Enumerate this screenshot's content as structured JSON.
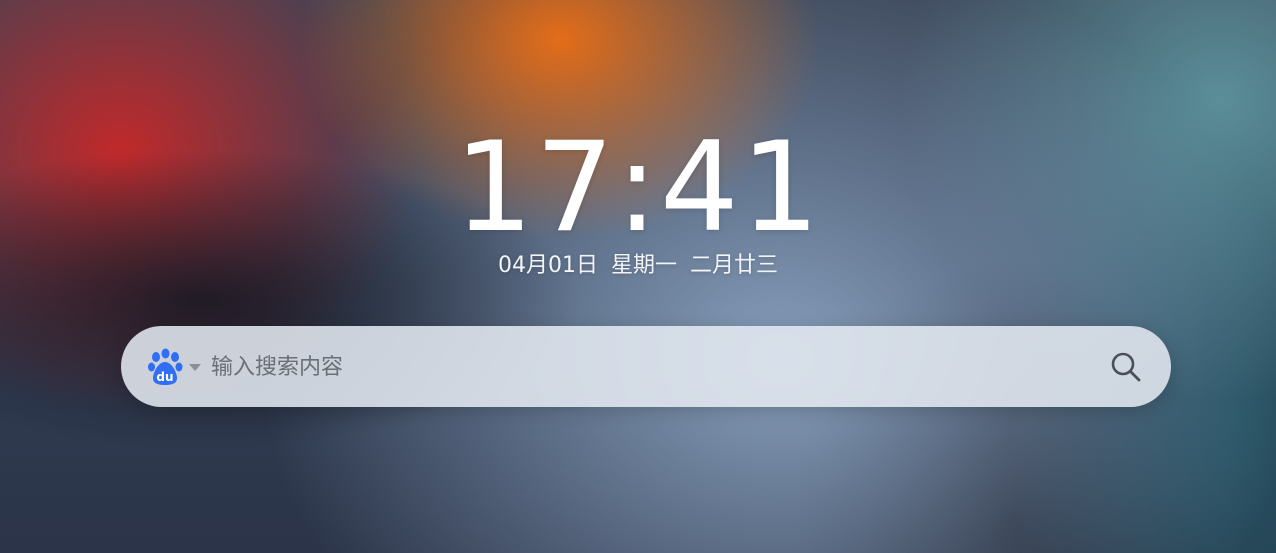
{
  "clock": {
    "time": "17:41",
    "date": "04月01日",
    "weekday": "星期一",
    "lunar_date": "二月廿三"
  },
  "search": {
    "engine": "baidu-icon",
    "placeholder": "输入搜索内容",
    "value": ""
  },
  "colors": {
    "baidu_blue": "#2f6ef5",
    "text_white": "#ffffff",
    "search_bar_bg": "#e2e8f0"
  }
}
